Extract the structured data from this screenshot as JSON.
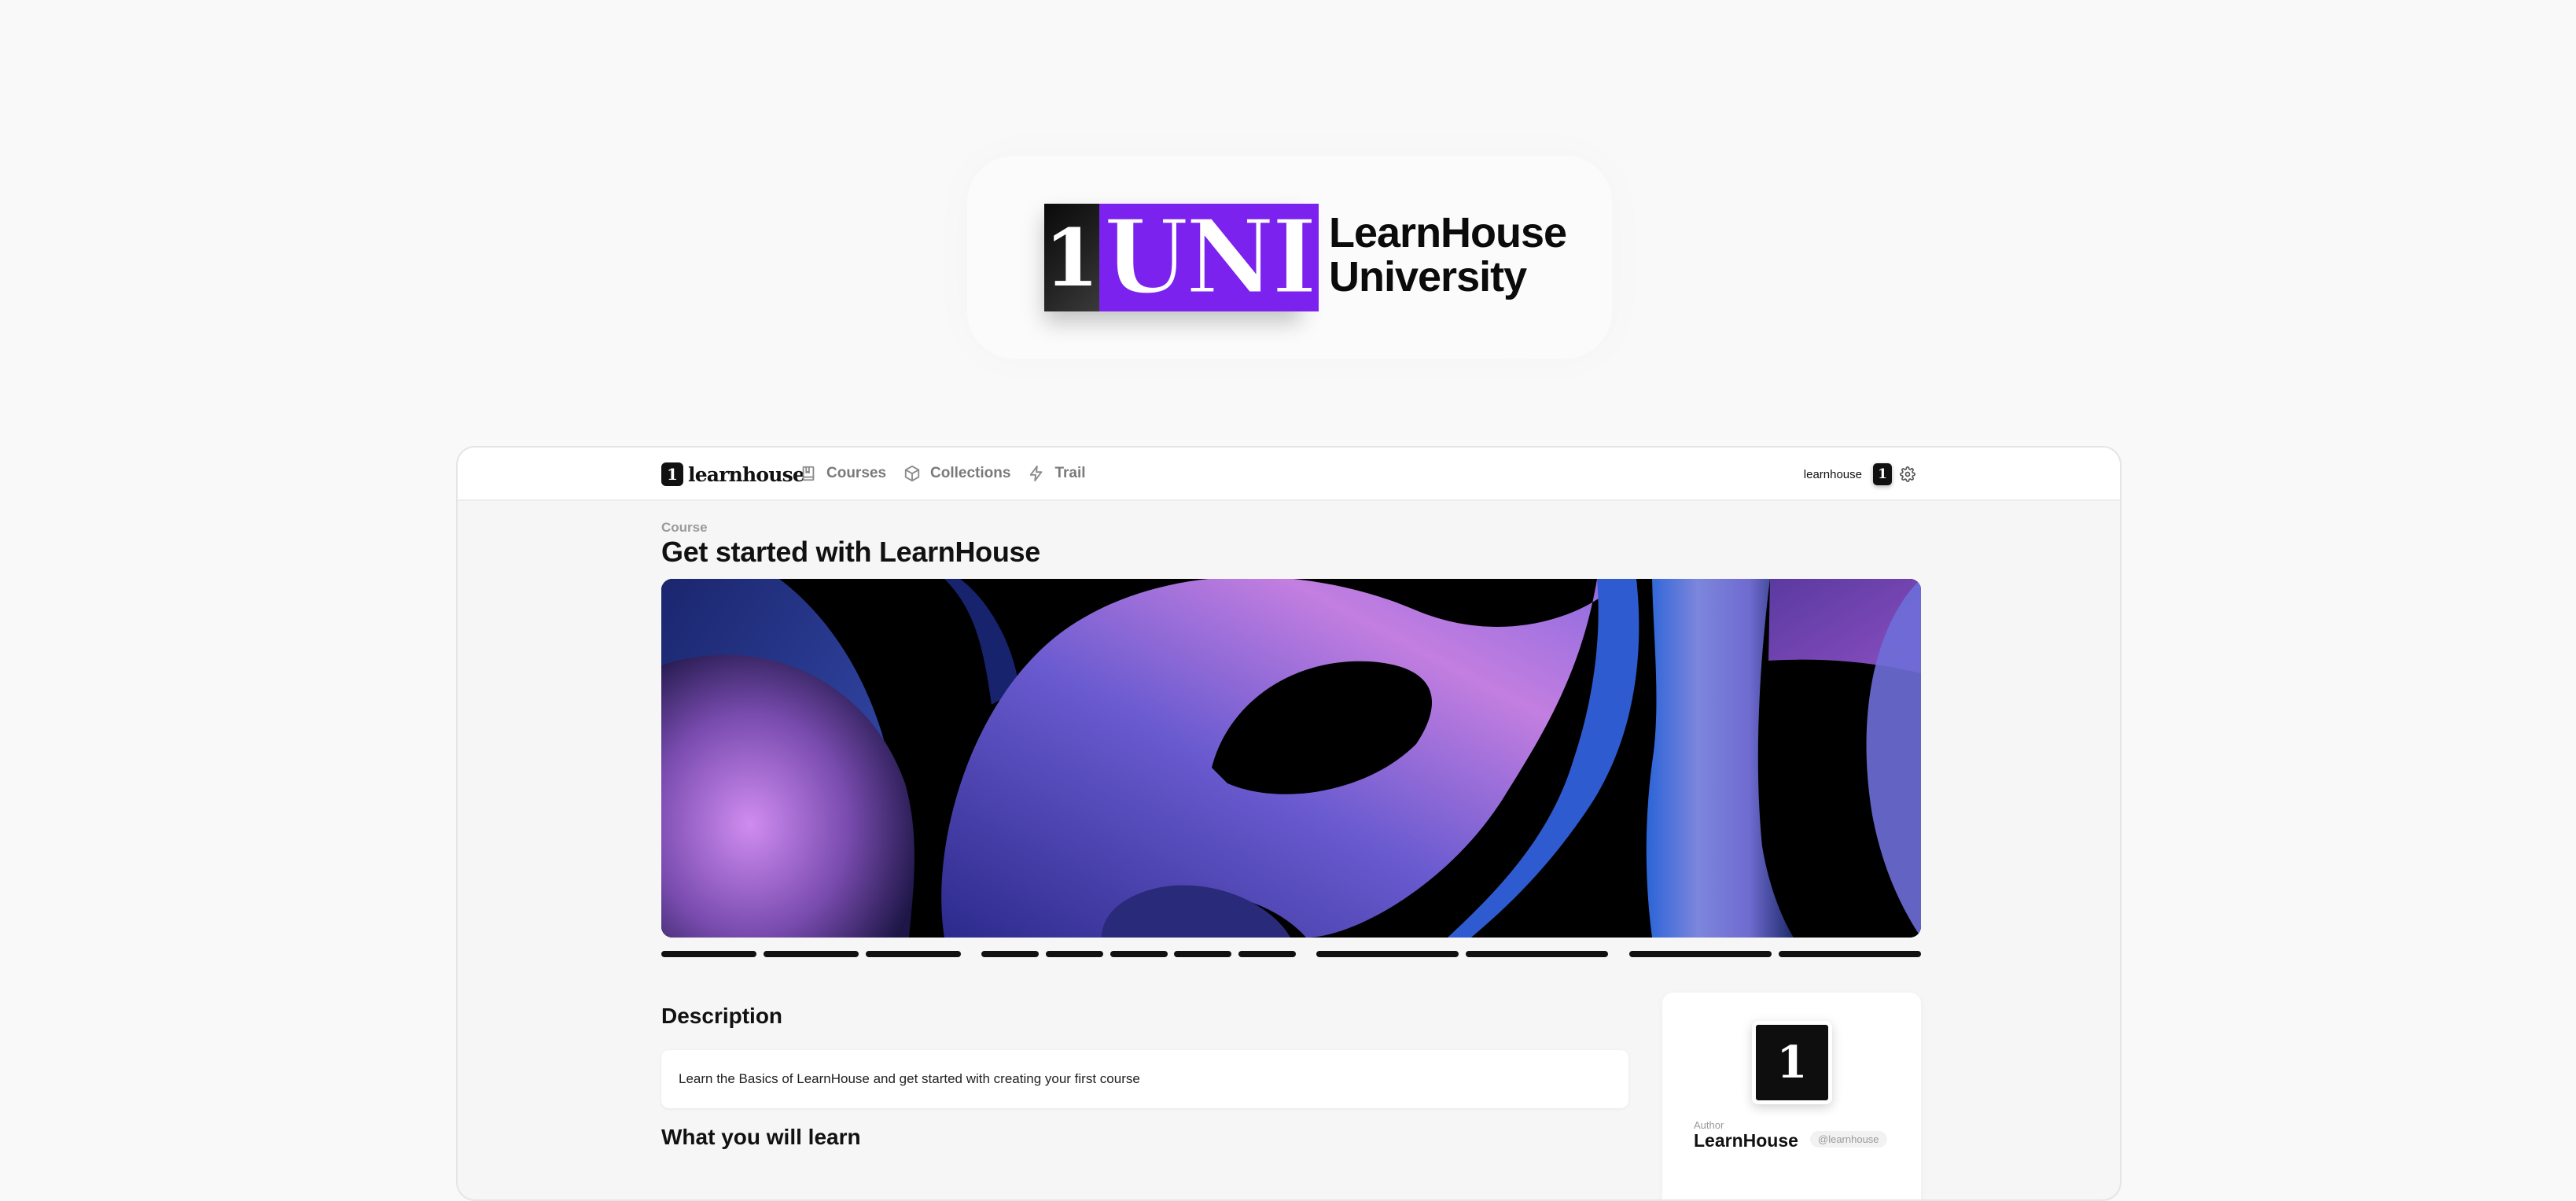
{
  "hero": {
    "logo_mark": "1",
    "logo_uni": "UNI",
    "name_line1": "LearnHouse",
    "name_line2": "University",
    "accent_color": "#7c22ee"
  },
  "navbar": {
    "brand_mark": "1",
    "brand_word": "learnhouse",
    "links": [
      {
        "label": "Courses",
        "icon": "book-icon"
      },
      {
        "label": "Collections",
        "icon": "box-icon"
      },
      {
        "label": "Trail",
        "icon": "zap-icon"
      }
    ],
    "org_name": "learnhouse",
    "avatar_mark": "1",
    "settings_icon": "gear-icon"
  },
  "course": {
    "crumb": "Course",
    "title": "Get started with LearnHouse",
    "cover_alt": "abstract purple and blue shapes"
  },
  "description": {
    "heading": "Description",
    "text": "Learn the Basics of LearnHouse and get started with creating your first course"
  },
  "learn": {
    "heading": "What you will learn"
  },
  "author": {
    "label": "Author",
    "name": "LearnHouse",
    "handle": "@learnhouse",
    "avatar_mark": "1"
  }
}
